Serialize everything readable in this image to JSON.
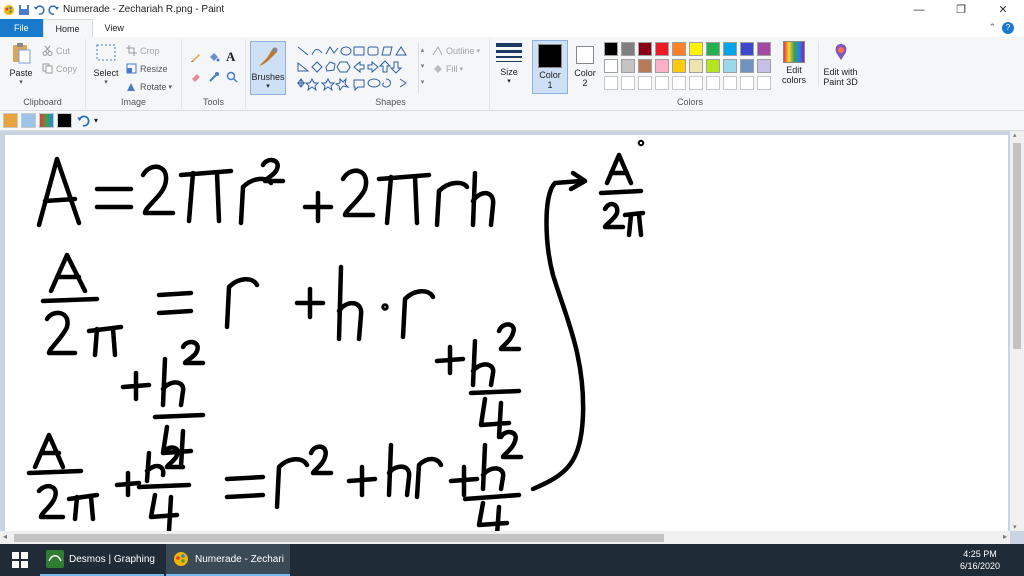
{
  "window": {
    "title": "Numerade - Zechariah R.png - Paint"
  },
  "tabs": {
    "file": "File",
    "home": "Home",
    "view": "View"
  },
  "ribbon": {
    "clipboard": {
      "label": "Clipboard",
      "paste": "Paste",
      "cut": "Cut",
      "copy": "Copy"
    },
    "image": {
      "label": "Image",
      "select": "Select",
      "crop": "Crop",
      "resize": "Resize",
      "rotate": "Rotate"
    },
    "tools": {
      "label": "Tools"
    },
    "brushes": {
      "label": "Brushes"
    },
    "shapes": {
      "label": "Shapes",
      "outline": "Outline",
      "fill": "Fill"
    },
    "size": {
      "label": "Size"
    },
    "color1": {
      "label1": "Color",
      "label2": "1",
      "value": "#000000"
    },
    "color2": {
      "label1": "Color",
      "label2": "2",
      "value": "#ffffff"
    },
    "colors": {
      "label": "Colors",
      "row1": [
        "#000000",
        "#7f7f7f",
        "#880015",
        "#ed1c24",
        "#ff7f27",
        "#fff200",
        "#22b14c",
        "#00a2e8",
        "#3f48cc",
        "#a349a4"
      ],
      "row2": [
        "#ffffff",
        "#c3c3c3",
        "#b97a57",
        "#ffaec9",
        "#ffc90e",
        "#efe4b0",
        "#b5e61d",
        "#99d9ea",
        "#7092be",
        "#c8bfe7"
      ],
      "row3": [
        "#ffffff",
        "#ffffff",
        "#ffffff",
        "#ffffff",
        "#ffffff",
        "#ffffff",
        "#ffffff",
        "#ffffff",
        "#ffffff",
        "#ffffff"
      ]
    },
    "edit_colors": {
      "line1": "Edit",
      "line2": "colors"
    },
    "paint3d": {
      "line1": "Edit with",
      "line2": "Paint 3D"
    }
  },
  "taskbar": {
    "items": [
      {
        "label": "Desmos | Graphing ..."
      },
      {
        "label": "Numerade - Zechari..."
      }
    ],
    "time": "4:25 PM",
    "date": "6/16/2020"
  }
}
